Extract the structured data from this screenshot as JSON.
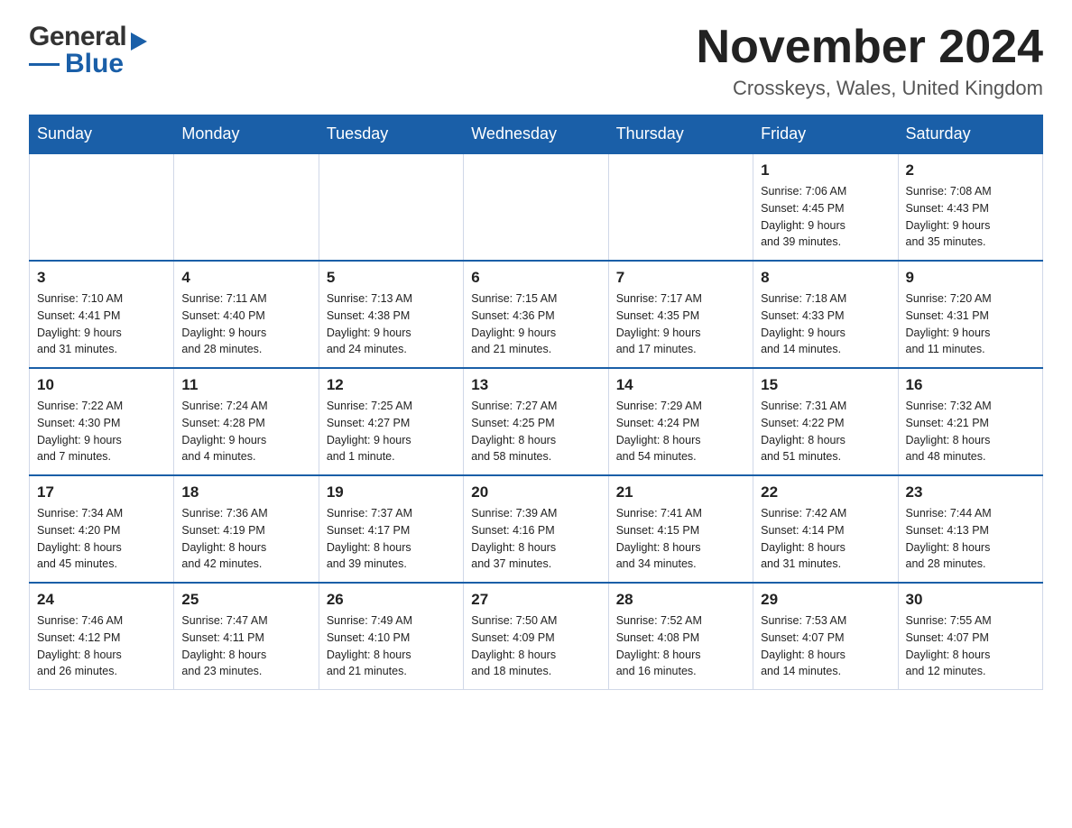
{
  "header": {
    "month_title": "November 2024",
    "location": "Crosskeys, Wales, United Kingdom"
  },
  "days_of_week": [
    "Sunday",
    "Monday",
    "Tuesday",
    "Wednesday",
    "Thursday",
    "Friday",
    "Saturday"
  ],
  "weeks": [
    [
      {
        "day": "",
        "info": ""
      },
      {
        "day": "",
        "info": ""
      },
      {
        "day": "",
        "info": ""
      },
      {
        "day": "",
        "info": ""
      },
      {
        "day": "",
        "info": ""
      },
      {
        "day": "1",
        "info": "Sunrise: 7:06 AM\nSunset: 4:45 PM\nDaylight: 9 hours\nand 39 minutes."
      },
      {
        "day": "2",
        "info": "Sunrise: 7:08 AM\nSunset: 4:43 PM\nDaylight: 9 hours\nand 35 minutes."
      }
    ],
    [
      {
        "day": "3",
        "info": "Sunrise: 7:10 AM\nSunset: 4:41 PM\nDaylight: 9 hours\nand 31 minutes."
      },
      {
        "day": "4",
        "info": "Sunrise: 7:11 AM\nSunset: 4:40 PM\nDaylight: 9 hours\nand 28 minutes."
      },
      {
        "day": "5",
        "info": "Sunrise: 7:13 AM\nSunset: 4:38 PM\nDaylight: 9 hours\nand 24 minutes."
      },
      {
        "day": "6",
        "info": "Sunrise: 7:15 AM\nSunset: 4:36 PM\nDaylight: 9 hours\nand 21 minutes."
      },
      {
        "day": "7",
        "info": "Sunrise: 7:17 AM\nSunset: 4:35 PM\nDaylight: 9 hours\nand 17 minutes."
      },
      {
        "day": "8",
        "info": "Sunrise: 7:18 AM\nSunset: 4:33 PM\nDaylight: 9 hours\nand 14 minutes."
      },
      {
        "day": "9",
        "info": "Sunrise: 7:20 AM\nSunset: 4:31 PM\nDaylight: 9 hours\nand 11 minutes."
      }
    ],
    [
      {
        "day": "10",
        "info": "Sunrise: 7:22 AM\nSunset: 4:30 PM\nDaylight: 9 hours\nand 7 minutes."
      },
      {
        "day": "11",
        "info": "Sunrise: 7:24 AM\nSunset: 4:28 PM\nDaylight: 9 hours\nand 4 minutes."
      },
      {
        "day": "12",
        "info": "Sunrise: 7:25 AM\nSunset: 4:27 PM\nDaylight: 9 hours\nand 1 minute."
      },
      {
        "day": "13",
        "info": "Sunrise: 7:27 AM\nSunset: 4:25 PM\nDaylight: 8 hours\nand 58 minutes."
      },
      {
        "day": "14",
        "info": "Sunrise: 7:29 AM\nSunset: 4:24 PM\nDaylight: 8 hours\nand 54 minutes."
      },
      {
        "day": "15",
        "info": "Sunrise: 7:31 AM\nSunset: 4:22 PM\nDaylight: 8 hours\nand 51 minutes."
      },
      {
        "day": "16",
        "info": "Sunrise: 7:32 AM\nSunset: 4:21 PM\nDaylight: 8 hours\nand 48 minutes."
      }
    ],
    [
      {
        "day": "17",
        "info": "Sunrise: 7:34 AM\nSunset: 4:20 PM\nDaylight: 8 hours\nand 45 minutes."
      },
      {
        "day": "18",
        "info": "Sunrise: 7:36 AM\nSunset: 4:19 PM\nDaylight: 8 hours\nand 42 minutes."
      },
      {
        "day": "19",
        "info": "Sunrise: 7:37 AM\nSunset: 4:17 PM\nDaylight: 8 hours\nand 39 minutes."
      },
      {
        "day": "20",
        "info": "Sunrise: 7:39 AM\nSunset: 4:16 PM\nDaylight: 8 hours\nand 37 minutes."
      },
      {
        "day": "21",
        "info": "Sunrise: 7:41 AM\nSunset: 4:15 PM\nDaylight: 8 hours\nand 34 minutes."
      },
      {
        "day": "22",
        "info": "Sunrise: 7:42 AM\nSunset: 4:14 PM\nDaylight: 8 hours\nand 31 minutes."
      },
      {
        "day": "23",
        "info": "Sunrise: 7:44 AM\nSunset: 4:13 PM\nDaylight: 8 hours\nand 28 minutes."
      }
    ],
    [
      {
        "day": "24",
        "info": "Sunrise: 7:46 AM\nSunset: 4:12 PM\nDaylight: 8 hours\nand 26 minutes."
      },
      {
        "day": "25",
        "info": "Sunrise: 7:47 AM\nSunset: 4:11 PM\nDaylight: 8 hours\nand 23 minutes."
      },
      {
        "day": "26",
        "info": "Sunrise: 7:49 AM\nSunset: 4:10 PM\nDaylight: 8 hours\nand 21 minutes."
      },
      {
        "day": "27",
        "info": "Sunrise: 7:50 AM\nSunset: 4:09 PM\nDaylight: 8 hours\nand 18 minutes."
      },
      {
        "day": "28",
        "info": "Sunrise: 7:52 AM\nSunset: 4:08 PM\nDaylight: 8 hours\nand 16 minutes."
      },
      {
        "day": "29",
        "info": "Sunrise: 7:53 AM\nSunset: 4:07 PM\nDaylight: 8 hours\nand 14 minutes."
      },
      {
        "day": "30",
        "info": "Sunrise: 7:55 AM\nSunset: 4:07 PM\nDaylight: 8 hours\nand 12 minutes."
      }
    ]
  ]
}
